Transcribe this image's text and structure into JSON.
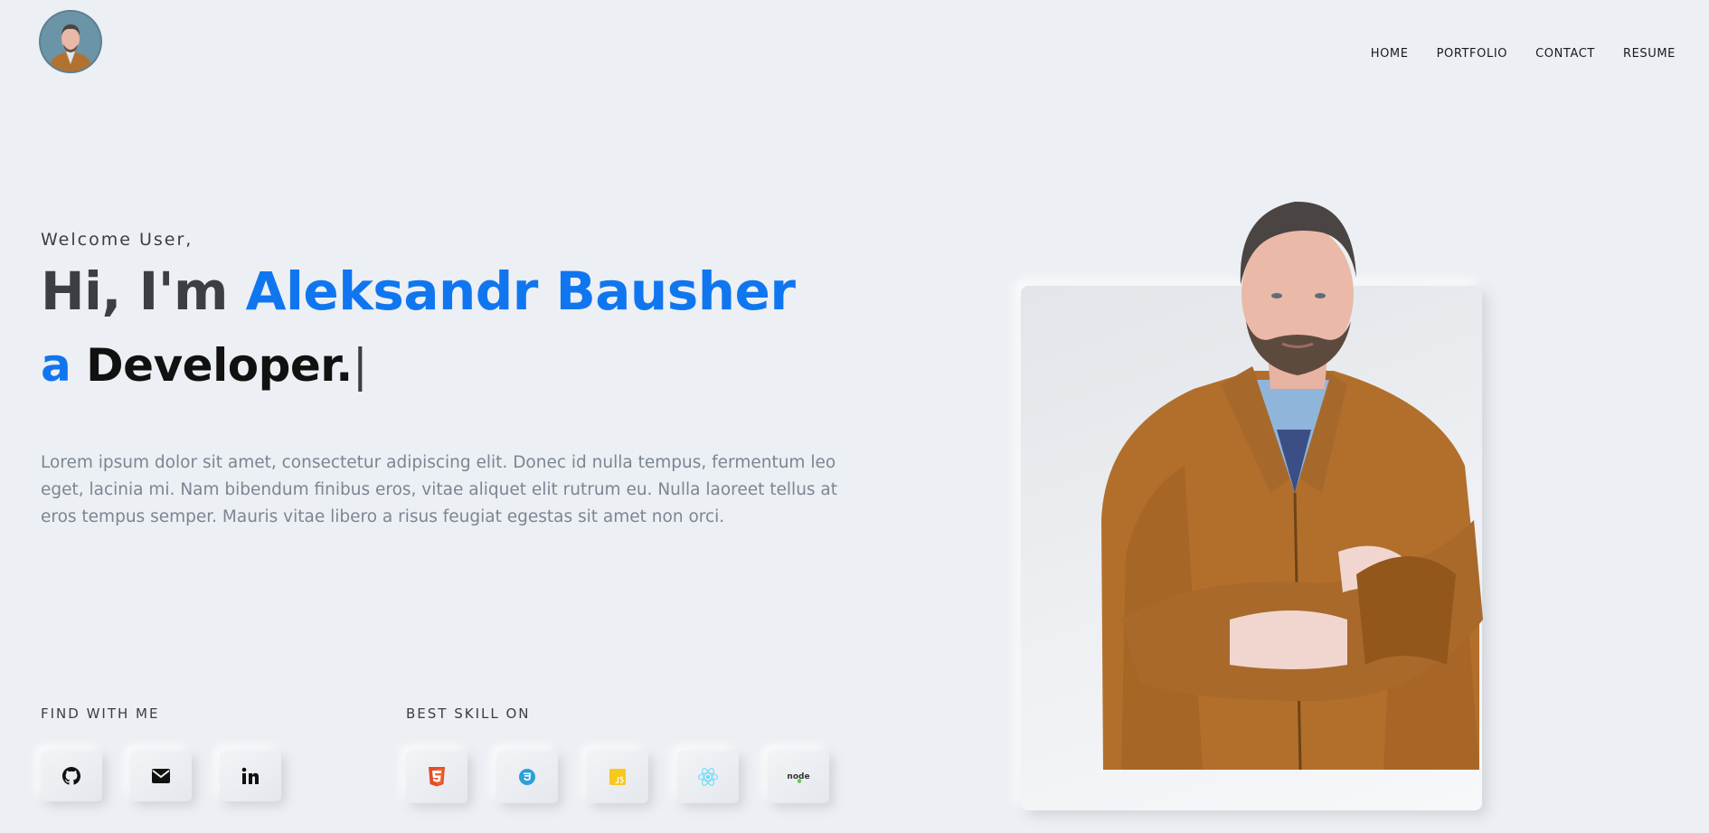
{
  "header": {
    "avatar_alt": "profile photo",
    "nav": [
      {
        "label": "HOME"
      },
      {
        "label": "PORTFOLIO"
      },
      {
        "label": "CONTACT"
      },
      {
        "label": "RESUME"
      }
    ]
  },
  "hero": {
    "welcome": "Welcome User,",
    "greeting": "Hi, I'm ",
    "name": "Aleksandr Bausher",
    "article": "a",
    "role": "Developer.",
    "cursor": "|",
    "description": "Lorem ipsum dolor sit amet, consectetur adipiscing elit. Donec id nulla tempus, fermentum leo eget, lacinia mi. Nam bibendum finibus eros, vitae aliquet elit rutrum eu. Nulla laoreet tellus at eros tempus semper. Mauris vitae libero a risus feugiat egestas sit amet non orci."
  },
  "find": {
    "label": "FIND WITH ME",
    "links": [
      {
        "icon": "github-icon"
      },
      {
        "icon": "mail-icon"
      },
      {
        "icon": "linkedin-icon"
      }
    ]
  },
  "skills": {
    "label": "BEST SKILL ON",
    "items": [
      {
        "icon": "html5-icon"
      },
      {
        "icon": "css3-icon"
      },
      {
        "icon": "javascript-icon"
      },
      {
        "icon": "react-icon"
      },
      {
        "icon": "nodejs-icon",
        "text": "node"
      }
    ]
  },
  "colors": {
    "accent": "#1076f0",
    "background": "#eceff3",
    "heading": "#3c3e41",
    "body_text": "#7c8593"
  }
}
